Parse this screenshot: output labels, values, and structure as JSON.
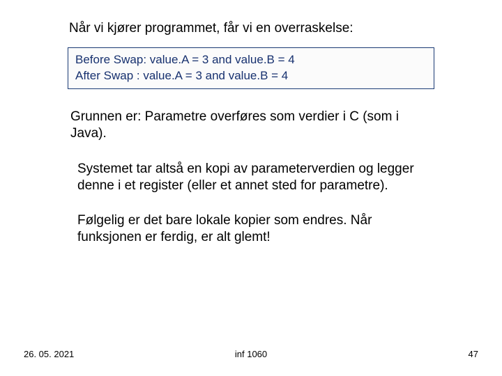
{
  "heading": "Når vi kjører programmet, får vi en overraskelse:",
  "output": {
    "line1": "Before Swap: value.A = 3 and value.B = 4",
    "line2": "After Swap : value.A = 3 and value.B = 4"
  },
  "paragraphs": {
    "p1": "Grunnen er: Parametre overføres som verdier i C (som i Java).",
    "p2": "Systemet tar altså en kopi av parameterverdien og legger denne i et register (eller et annet sted for parametre).",
    "p3": "Følgelig er det bare lokale kopier som endres. Når funksjonen er ferdig, er alt glemt!"
  },
  "footer": {
    "date": "26. 05. 2021",
    "course": "inf 1060",
    "page": "47"
  }
}
